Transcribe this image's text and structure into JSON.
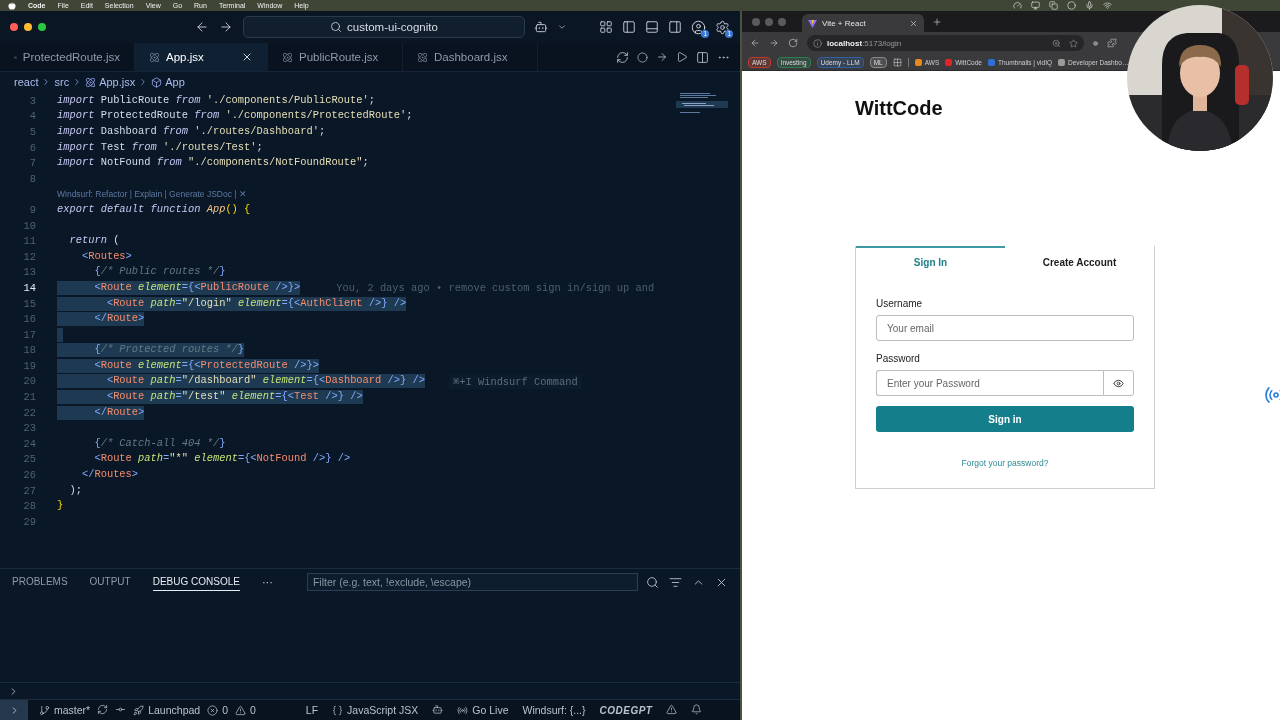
{
  "menu_bar": {
    "app": "Code",
    "items": [
      "File",
      "Edit",
      "Selection",
      "View",
      "Go",
      "Run",
      "Terminal",
      "Window",
      "Help"
    ]
  },
  "editor": {
    "search": "custom-ui-cognito",
    "account_badge": "1",
    "settings_badge": "1",
    "tabs": [
      {
        "label": "ProtectedRoute.jsx",
        "selected": false
      },
      {
        "label": "App.jsx",
        "selected": true
      },
      {
        "label": "PublicRoute.jsx",
        "selected": false
      },
      {
        "label": "Dashboard.jsx",
        "selected": false
      }
    ],
    "breadcrumbs": [
      {
        "kind": "folder",
        "label": "react"
      },
      {
        "kind": "folder",
        "label": "src"
      },
      {
        "kind": "file",
        "label": "App.jsx"
      },
      {
        "kind": "symbol",
        "label": "App"
      }
    ],
    "lines": [
      {
        "number": "3",
        "selected": false,
        "current": false,
        "tokens": [
          {
            "kind": "kw",
            "text": "import"
          },
          {
            "kind": "id",
            "text": " PublicRoute "
          },
          {
            "kind": "kw",
            "text": "from"
          },
          {
            "kind": "str",
            "text": " './components/PublicRoute'"
          },
          {
            "kind": "p",
            "text": ";"
          }
        ]
      },
      {
        "number": "4",
        "selected": false,
        "current": false,
        "tokens": [
          {
            "kind": "kw",
            "text": "import"
          },
          {
            "kind": "id",
            "text": " ProtectedRoute "
          },
          {
            "kind": "kw",
            "text": "from"
          },
          {
            "kind": "str",
            "text": " './components/ProtectedRoute'"
          },
          {
            "kind": "p",
            "text": ";"
          }
        ]
      },
      {
        "number": "5",
        "selected": false,
        "current": false,
        "tokens": [
          {
            "kind": "kw",
            "text": "import"
          },
          {
            "kind": "id",
            "text": " Dashboard "
          },
          {
            "kind": "kw",
            "text": "from"
          },
          {
            "kind": "str",
            "text": " './routes/Dashboard'"
          },
          {
            "kind": "p",
            "text": ";"
          }
        ]
      },
      {
        "number": "6",
        "selected": false,
        "current": false,
        "tokens": [
          {
            "kind": "kw",
            "text": "import"
          },
          {
            "kind": "id",
            "text": " Test "
          },
          {
            "kind": "kw",
            "text": "from"
          },
          {
            "kind": "str",
            "text": " './routes/Test'"
          },
          {
            "kind": "p",
            "text": ";"
          }
        ]
      },
      {
        "number": "7",
        "selected": false,
        "current": false,
        "tokens": [
          {
            "kind": "kw",
            "text": "import"
          },
          {
            "kind": "id",
            "text": " NotFound "
          },
          {
            "kind": "kw",
            "text": "from"
          },
          {
            "kind": "str",
            "text": " \"./components/NotFoundRoute\""
          },
          {
            "kind": "p",
            "text": ";"
          }
        ]
      },
      {
        "number": "8",
        "selected": false,
        "current": false
      },
      {
        "number": "9",
        "selected": false,
        "current": false,
        "codelens": "Windsurf: Refactor | Explain | Generate JSDoc | ✕",
        "tokens": [
          {
            "kind": "kw",
            "text": "export default function"
          },
          {
            "kind": "fn",
            "text": " App"
          },
          {
            "kind": "y",
            "text": "() {"
          }
        ]
      },
      {
        "number": "10",
        "selected": false,
        "current": false
      },
      {
        "number": "11",
        "selected": false,
        "current": false,
        "tokens": [
          {
            "kind": "kw",
            "text": "  return"
          },
          {
            "kind": "p",
            "text": " ("
          }
        ]
      },
      {
        "number": "12",
        "selected": false,
        "current": false,
        "tokens": [
          {
            "kind": "br",
            "text": "    <"
          },
          {
            "kind": "tag",
            "text": "Routes"
          },
          {
            "kind": "br",
            "text": ">"
          }
        ]
      },
      {
        "number": "13",
        "selected": false,
        "current": false,
        "tokens": [
          {
            "kind": "br",
            "text": "      {"
          },
          {
            "kind": "cm",
            "text": "/* Public routes */"
          },
          {
            "kind": "br",
            "text": "}"
          }
        ]
      },
      {
        "number": "14",
        "selected": true,
        "current": true,
        "annotation": {
          "kind": "blame",
          "text": "You, 2 days ago • remove custom sign in/sign up and"
        },
        "tokens": [
          {
            "kind": "br",
            "text": "      <"
          },
          {
            "kind": "tag",
            "text": "Route"
          },
          {
            "kind": "attr",
            "text": " element"
          },
          {
            "kind": "br",
            "text": "={<"
          },
          {
            "kind": "tag",
            "text": "PublicRoute"
          },
          {
            "kind": "br",
            "text": " />}>"
          }
        ]
      },
      {
        "number": "15",
        "selected": true,
        "current": false,
        "tokens": [
          {
            "kind": "br",
            "text": "        <"
          },
          {
            "kind": "tag",
            "text": "Route"
          },
          {
            "kind": "attr",
            "text": " path"
          },
          {
            "kind": "br",
            "text": "="
          },
          {
            "kind": "str",
            "text": "\"/login\""
          },
          {
            "kind": "attr",
            "text": " element"
          },
          {
            "kind": "br",
            "text": "={<"
          },
          {
            "kind": "tag",
            "text": "AuthClient"
          },
          {
            "kind": "br",
            "text": " />} />"
          }
        ]
      },
      {
        "number": "16",
        "selected": true,
        "current": false,
        "tokens": [
          {
            "kind": "br",
            "text": "      </"
          },
          {
            "kind": "tag",
            "text": "Route"
          },
          {
            "kind": "br",
            "text": ">"
          }
        ]
      },
      {
        "number": "17",
        "selected": true,
        "current": false
      },
      {
        "number": "18",
        "selected": true,
        "current": false,
        "tokens": [
          {
            "kind": "br",
            "text": "      {"
          },
          {
            "kind": "cm",
            "text": "/* Protected routes */"
          },
          {
            "kind": "br",
            "text": "}"
          }
        ]
      },
      {
        "number": "19",
        "selected": true,
        "current": false,
        "tokens": [
          {
            "kind": "br",
            "text": "      <"
          },
          {
            "kind": "tag",
            "text": "Route"
          },
          {
            "kind": "attr",
            "text": " element"
          },
          {
            "kind": "br",
            "text": "={<"
          },
          {
            "kind": "tag",
            "text": "ProtectedRoute"
          },
          {
            "kind": "br",
            "text": " />}>"
          }
        ]
      },
      {
        "number": "20",
        "selected": true,
        "current": false,
        "annotation": {
          "kind": "hint",
          "text": "⌘+I Windsurf Command"
        },
        "tokens": [
          {
            "kind": "br",
            "text": "        <"
          },
          {
            "kind": "tag",
            "text": "Route"
          },
          {
            "kind": "attr",
            "text": " path"
          },
          {
            "kind": "br",
            "text": "="
          },
          {
            "kind": "str",
            "text": "\"/dashboard\""
          },
          {
            "kind": "attr",
            "text": " element"
          },
          {
            "kind": "br",
            "text": "={<"
          },
          {
            "kind": "tag",
            "text": "Dashboard"
          },
          {
            "kind": "br",
            "text": " />} />"
          }
        ]
      },
      {
        "number": "21",
        "selected": true,
        "current": false,
        "tokens": [
          {
            "kind": "br",
            "text": "        <"
          },
          {
            "kind": "tag",
            "text": "Route"
          },
          {
            "kind": "attr",
            "text": " path"
          },
          {
            "kind": "br",
            "text": "="
          },
          {
            "kind": "str",
            "text": "\"/test\""
          },
          {
            "kind": "attr",
            "text": " element"
          },
          {
            "kind": "br",
            "text": "={<"
          },
          {
            "kind": "tag",
            "text": "Test"
          },
          {
            "kind": "br",
            "text": " />} />"
          }
        ]
      },
      {
        "number": "22",
        "selected": true,
        "current": false,
        "tokens": [
          {
            "kind": "br",
            "text": "      </"
          },
          {
            "kind": "tag",
            "text": "Route"
          },
          {
            "kind": "br",
            "text": ">"
          }
        ]
      },
      {
        "number": "23",
        "selected": false,
        "current": false
      },
      {
        "number": "24",
        "selected": false,
        "current": false,
        "tokens": [
          {
            "kind": "br",
            "text": "      {"
          },
          {
            "kind": "cm",
            "text": "/* Catch-all 404 */"
          },
          {
            "kind": "br",
            "text": "}"
          }
        ]
      },
      {
        "number": "25",
        "selected": false,
        "current": false,
        "tokens": [
          {
            "kind": "br",
            "text": "      <"
          },
          {
            "kind": "tag",
            "text": "Route"
          },
          {
            "kind": "attr",
            "text": " path"
          },
          {
            "kind": "br",
            "text": "="
          },
          {
            "kind": "str",
            "text": "\"*\""
          },
          {
            "kind": "attr",
            "text": " element"
          },
          {
            "kind": "br",
            "text": "={<"
          },
          {
            "kind": "tag",
            "text": "NotFound"
          },
          {
            "kind": "br",
            "text": " />} />"
          }
        ]
      },
      {
        "number": "26",
        "selected": false,
        "current": false,
        "tokens": [
          {
            "kind": "br",
            "text": "    </"
          },
          {
            "kind": "tag",
            "text": "Routes"
          },
          {
            "kind": "br",
            "text": ">"
          }
        ]
      },
      {
        "number": "27",
        "selected": false,
        "current": false,
        "tokens": [
          {
            "kind": "p",
            "text": "  );"
          }
        ]
      },
      {
        "number": "28",
        "selected": false,
        "current": false,
        "tokens": [
          {
            "kind": "y",
            "text": "}"
          }
        ]
      },
      {
        "number": "29",
        "selected": false,
        "current": false
      }
    ]
  },
  "panel": {
    "tabs": [
      {
        "label": "PROBLEMS",
        "selected": false
      },
      {
        "label": "OUTPUT",
        "selected": false
      },
      {
        "label": "DEBUG CONSOLE",
        "selected": true
      }
    ],
    "more": "···",
    "filter_placeholder": "Filter (e.g. text, !exclude, \\escape)"
  },
  "status_bar": {
    "left_items": [
      {
        "kind": "remote"
      },
      {
        "kind": "branch",
        "text": "master*"
      },
      {
        "kind": "sync"
      },
      {
        "kind": "graph"
      },
      {
        "kind": "launchpad",
        "text": "Launchpad"
      },
      {
        "kind": "errors",
        "text": "0"
      },
      {
        "kind": "warnings",
        "text": "0"
      }
    ],
    "right_items": [
      {
        "kind": "plain",
        "text": "LF"
      },
      {
        "kind": "language",
        "text": "JavaScript JSX"
      },
      {
        "kind": "copilot"
      },
      {
        "kind": "live",
        "text": "Go Live"
      },
      {
        "kind": "plain",
        "text": "Windsurf: {...}"
      },
      {
        "kind": "brand",
        "text": "CODEGPT"
      },
      {
        "kind": "alert"
      },
      {
        "kind": "bell"
      }
    ]
  },
  "browser": {
    "tab_title": "Vite + React",
    "url_host": "localhost",
    "url_path": ":5173/login",
    "bookmarks": [
      {
        "kind": "tag",
        "label": "AWS",
        "color": "#c0392b"
      },
      {
        "kind": "tag",
        "label": "Investing",
        "color": "#2e7d4f"
      },
      {
        "kind": "tag",
        "label": "Udemy - LLM",
        "color": "#2f5f9e"
      },
      {
        "kind": "tag",
        "label": "ML",
        "color": "#8a8a8a"
      },
      {
        "kind": "apps"
      },
      {
        "kind": "link",
        "label": "AWS",
        "color": "#e8891c"
      },
      {
        "kind": "link",
        "label": "WittCode",
        "color": "#e0242b"
      },
      {
        "kind": "link",
        "label": "Thumbnails | vidIQ",
        "color": "#2d6fd6"
      },
      {
        "kind": "link",
        "label": "Developer Dashbo…",
        "color": "#9a9a9a"
      }
    ]
  },
  "page": {
    "brand": "WittCode",
    "tabs": [
      {
        "label": "Sign In",
        "selected": true
      },
      {
        "label": "Create Account",
        "selected": false
      }
    ],
    "fields": [
      {
        "kind": "text",
        "label": "Username",
        "placeholder": "Your email"
      },
      {
        "kind": "password",
        "label": "Password",
        "placeholder": "Enter your Password"
      }
    ],
    "submit": "Sign in",
    "forgot": "Forgot your password?"
  }
}
